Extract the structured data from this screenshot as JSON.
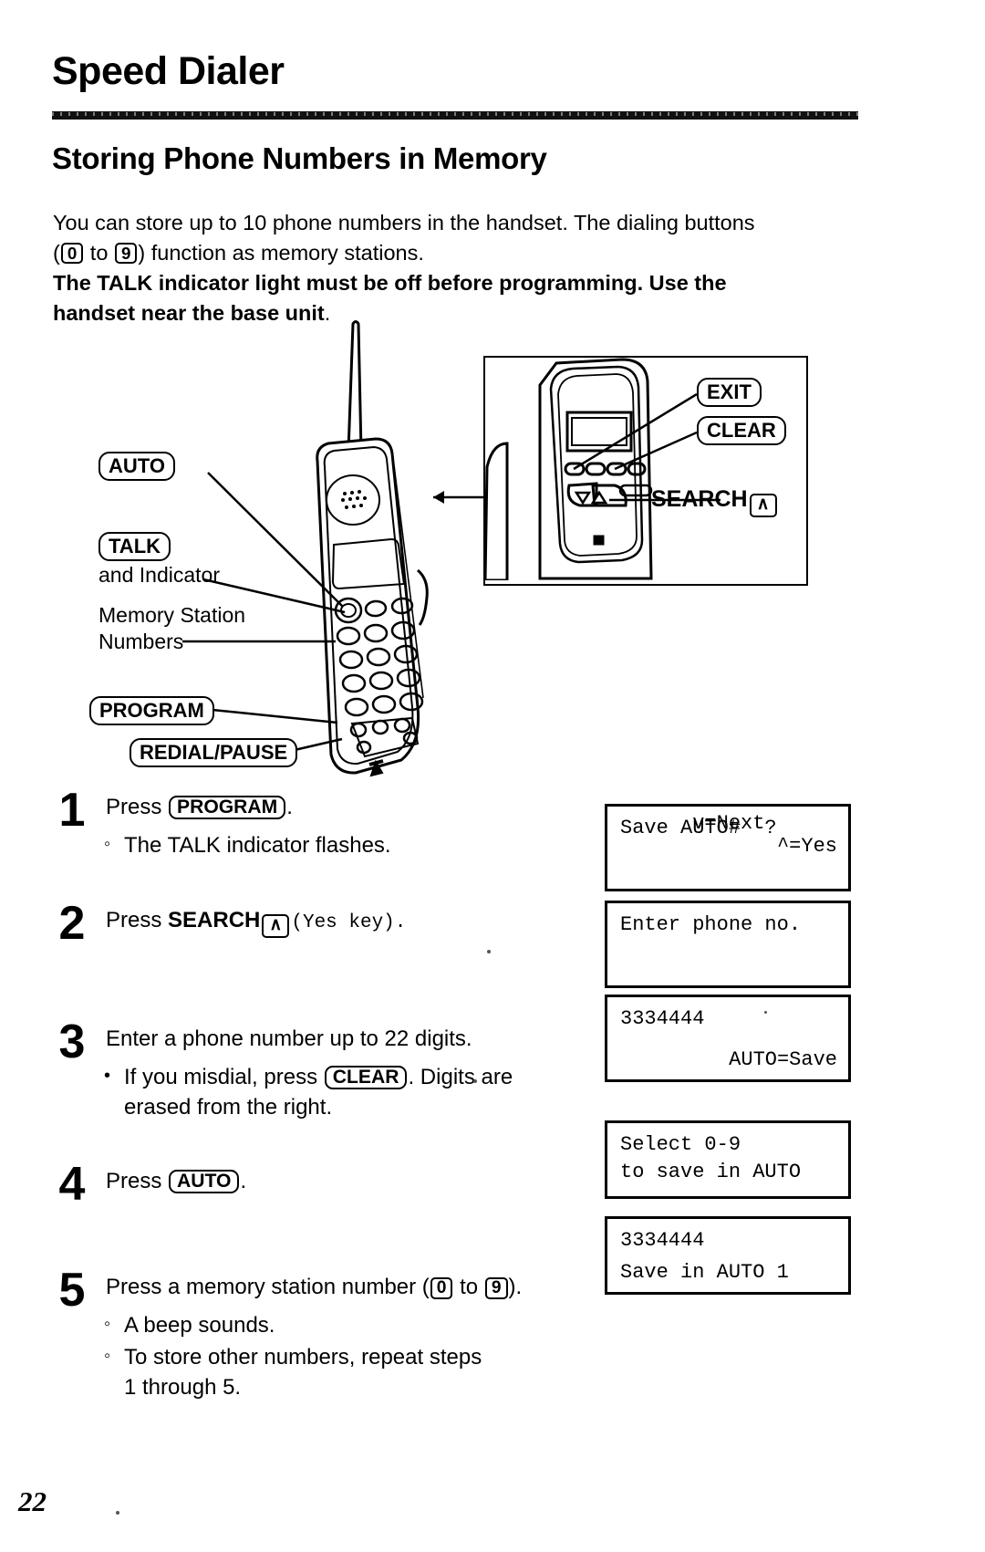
{
  "page": {
    "title": "Speed Dialer",
    "section_heading": "Storing Phone Numbers in Memory",
    "page_number": "22"
  },
  "intro": {
    "line1_a": "You can store up to 10 phone numbers in the handset. The dialing buttons",
    "line2_key_open": "(",
    "line2_key_0": "0",
    "line2_mid": " to ",
    "line2_key_9": "9",
    "line2_close": ") function as memory stations.",
    "bold_line1": "The TALK indicator light must be off before programming. Use the",
    "bold_line2_a": "handset near the base unit",
    "bold_line2_b": "."
  },
  "figure": {
    "labels": {
      "auto": "AUTO",
      "talk": "TALK",
      "and_indicator": "and Indicator",
      "memory_station_1": "Memory Station",
      "memory_station_2": "Numbers",
      "program": "PROGRAM",
      "redial_pause": "REDIAL/PAUSE",
      "exit": "EXIT",
      "clear": "CLEAR",
      "search": "SEARCH",
      "search_key_glyph": "∧"
    }
  },
  "steps": [
    {
      "number": "1",
      "text_before": "Press ",
      "key": "PROGRAM",
      "text_after": ".",
      "bullets": [
        "The TALK indicator flashes."
      ]
    },
    {
      "number": "2",
      "text_before": "Press ",
      "bold_word": "SEARCH",
      "arrow_key": "∧",
      "text_after": "(Yes key).",
      "bullets": []
    },
    {
      "number": "3",
      "text_before": "Enter a phone number up to 22 digits.",
      "key": "CLEAR",
      "bullets_rich": {
        "pre": "If you misdial, press ",
        "key": "CLEAR",
        "post": ". Digits are",
        "line2": "erased from the right."
      },
      "bullets": []
    },
    {
      "number": "4",
      "text_before": "Press ",
      "key": "AUTO",
      "text_after": ".",
      "bullets": []
    },
    {
      "number": "5",
      "text_before": "Press a memory station number (",
      "key_0": "0",
      "text_mid": " to ",
      "key_9": "9",
      "text_after": ").",
      "bullets": [
        "A beep sounds.",
        "To store other numbers, repeat steps",
        "1 through 5."
      ]
    }
  ],
  "lcd_panels": [
    {
      "line1": "Save AUTO#  ?",
      "line2_left": "v=Next",
      "line2_right": "^=Yes"
    },
    {
      "line1": "Enter phone no.",
      "line2_left": "",
      "line2_right": ""
    },
    {
      "line1": "3334444",
      "line2_left": "",
      "line2_right": "AUTO=Save"
    },
    {
      "line1": "Select 0-9",
      "line2_left": "to save in AUTO",
      "line2_right": ""
    },
    {
      "line1": "3334444",
      "line2_left": "Save in AUTO 1",
      "line2_right": ""
    }
  ]
}
